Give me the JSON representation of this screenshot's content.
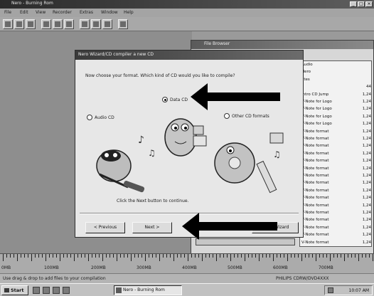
{
  "app": {
    "title": "Nero - Burning Rom",
    "window_controls": [
      "_",
      "□",
      "×"
    ]
  },
  "menubar": {
    "items": [
      "File",
      "Edit",
      "View",
      "Recorder",
      "Extras",
      "Window",
      "Help"
    ]
  },
  "toolbar": {
    "buttons": [
      "new-icon",
      "open-icon",
      "save-icon",
      "cut-icon",
      "copy-icon",
      "paste-icon",
      "burn-icon",
      "properties-icon",
      "info-icon",
      "help-icon"
    ]
  },
  "browser": {
    "title": "File Browser",
    "files": [
      {
        "name": "Audio",
        "size": ""
      },
      {
        "name": "Nero",
        "size": ""
      },
      {
        "name": "ates",
        "size": ""
      },
      {
        "name": "",
        "size": "44"
      },
      {
        "name": "Intro CD Jump",
        "size": "1,24"
      },
      {
        "name": "V-Note for Logo",
        "size": "1,24"
      },
      {
        "name": "V-Note for Logo",
        "size": "1,24"
      },
      {
        "name": "V-Note for Logo",
        "size": "1,24"
      },
      {
        "name": "V-Note for Logo",
        "size": "1,24"
      },
      {
        "name": "V-Note format",
        "size": "1,24"
      },
      {
        "name": "V-Note format",
        "size": "1,24"
      },
      {
        "name": "V-Note format",
        "size": "1,24"
      },
      {
        "name": "V-Note format",
        "size": "1,24"
      },
      {
        "name": "V-Note format",
        "size": "1,24"
      },
      {
        "name": "V-Note format",
        "size": "1,24"
      },
      {
        "name": "V-Note format",
        "size": "1,24"
      },
      {
        "name": "V-Note format",
        "size": "1,24"
      },
      {
        "name": "V-Note format",
        "size": "1,24"
      },
      {
        "name": "V-Note format",
        "size": "1,24"
      },
      {
        "name": "V-Note format",
        "size": "1,24"
      },
      {
        "name": "V-Note format",
        "size": "1,24"
      },
      {
        "name": "V-Note format",
        "size": "1,24"
      },
      {
        "name": "V-Note format",
        "size": "1,24"
      },
      {
        "name": "V-Note format",
        "size": "1,24"
      },
      {
        "name": "V-Note format",
        "size": "1,24"
      }
    ]
  },
  "dialog": {
    "title": "Nero Wizard/CD compiler a new CD",
    "question": "Now choose your format. Which kind of CD would you like to compile?",
    "options": [
      {
        "label": "Data CD",
        "selected": true
      },
      {
        "label": "Audio CD",
        "selected": false
      },
      {
        "label": "Other CD formats",
        "selected": false
      }
    ],
    "instruction": "Click the Next button to continue.",
    "buttons": {
      "back": "< Previous",
      "next": "Next >",
      "cancel": "Close Wizard"
    }
  },
  "ruler": {
    "labels": [
      "0MB",
      "100MB",
      "200MB",
      "300MB",
      "400MB",
      "500MB",
      "600MB",
      "700MB"
    ]
  },
  "statusbar": {
    "hint": "Use drag & drop to add files to your compilation",
    "device": "PHILIPS CDRW/DVD4XXX"
  },
  "taskbar": {
    "start_label": "Start",
    "active_task": "Nero - Burning Rom",
    "clock": "10:07 AM"
  },
  "colors": {
    "arrow": "#000000",
    "dialog_bg": "#e7e7e7",
    "titlebar_dark": "#3a3a3a"
  }
}
